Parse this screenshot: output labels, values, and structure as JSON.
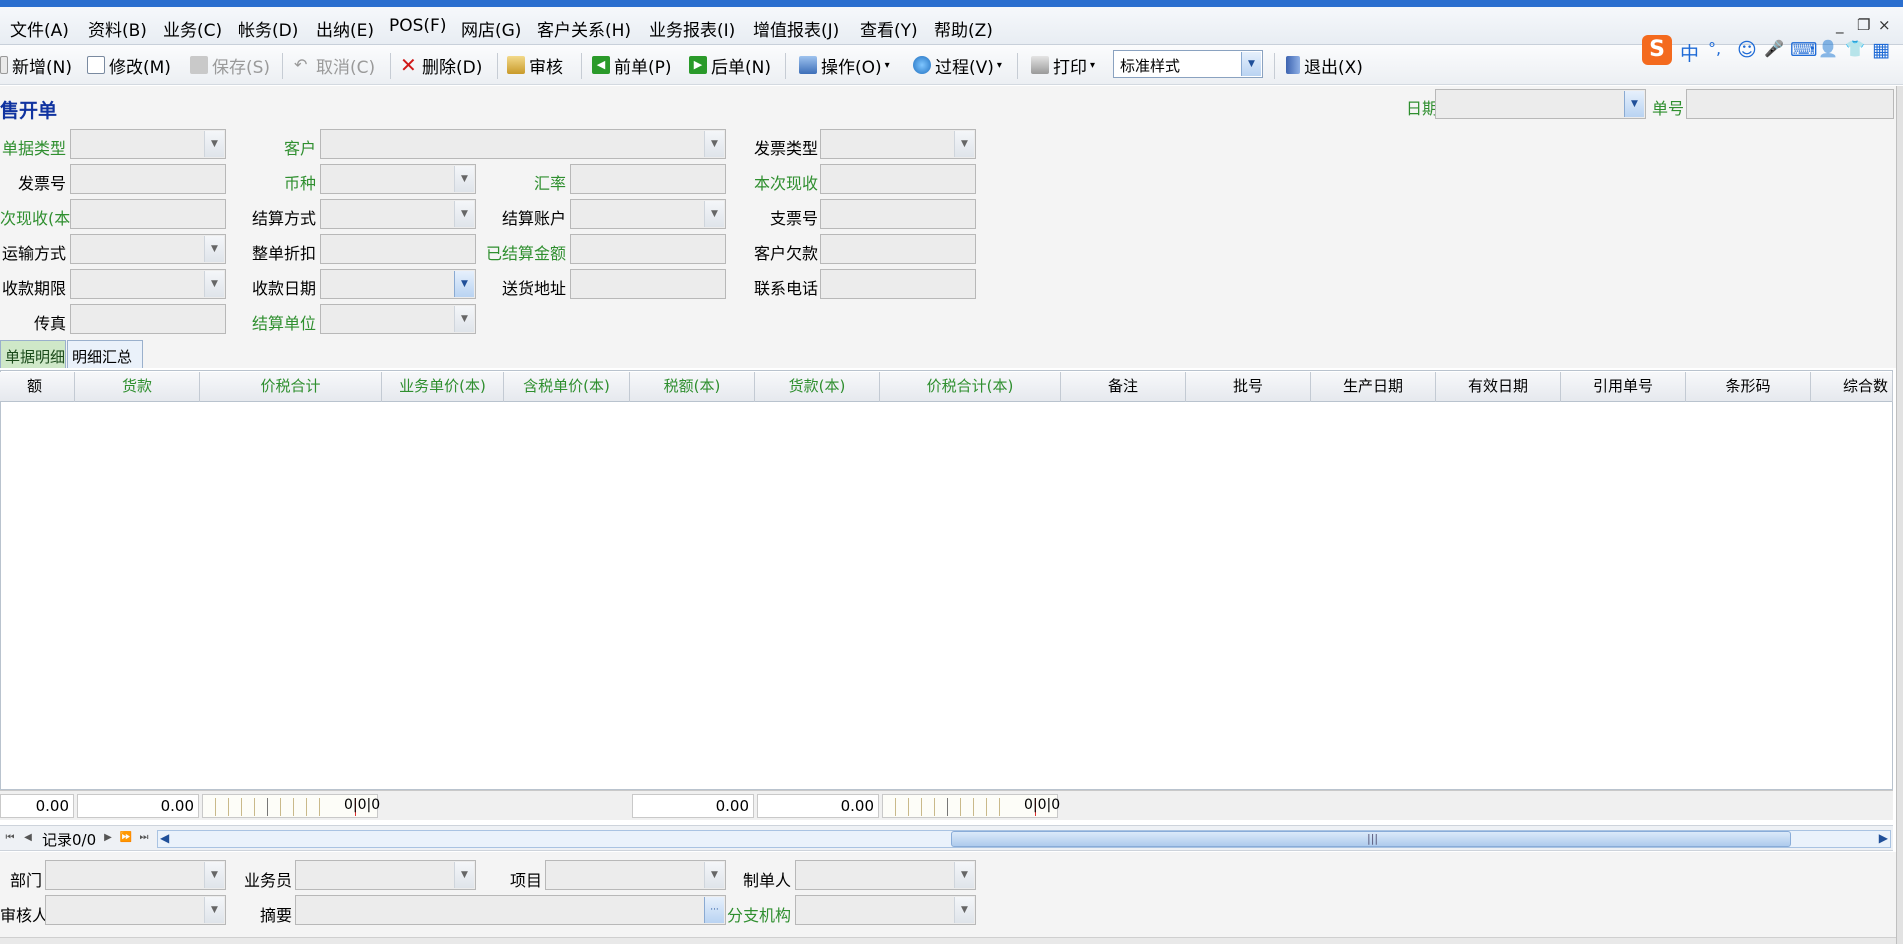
{
  "menu": {
    "items": [
      "文件(A)",
      "资料(B)",
      "业务(C)",
      "帐务(D)",
      "出纳(E)",
      "POS(F)",
      "网店(G)",
      "客户关系(H)",
      "业务报表(I)",
      "增值报表(J)",
      "查看(Y)",
      "帮助(Z)"
    ],
    "win_min": "_",
    "win_restore": "❐",
    "win_close": "×"
  },
  "toolbar": {
    "new": "新增(N)",
    "edit": "修改(M)",
    "save": "保存(S)",
    "cancel": "取消(C)",
    "delete": "删除(D)",
    "audit": "审核",
    "prev": "前单(P)",
    "next": "后单(N)",
    "operate": "操作(O)",
    "process": "过程(V)",
    "print": "打印",
    "style_value": "标准样式",
    "exit": "退出(X)"
  },
  "ime": {
    "logo": "S",
    "lang": "中",
    "punct": "°,",
    "emoji": "☺",
    "mic": "🎤",
    "keyboard": "⌨",
    "user": "👤",
    "shirt": "👕",
    "grid": "▦"
  },
  "form": {
    "title": "售开单",
    "date_label": "日期",
    "no_label": "单号",
    "doc_type": "单据类型",
    "customer": "客户",
    "invoice_type": "发票类型",
    "invoice_no": "发票号",
    "currency": "币种",
    "rate": "汇率",
    "cur_receipt": "本次现收",
    "cur_receipt_base": "次现收(本)",
    "settle_method": "结算方式",
    "settle_account": "结算账户",
    "check_no": "支票号",
    "transport": "运输方式",
    "discount": "整单折扣",
    "settled_amount": "已结算金额",
    "cust_debt": "客户欠款",
    "receipt_term": "收款期限",
    "receipt_date": "收款日期",
    "ship_addr": "送货地址",
    "phone": "联系电话",
    "fax": "传真",
    "settle_unit": "结算单位"
  },
  "tabs": [
    "单据明细",
    "明细汇总"
  ],
  "grid": {
    "columns": [
      "额",
      "货款",
      "价税合计",
      "业务单价(本)",
      "含税单价(本)",
      "税额(本)",
      "货款(本)",
      "价税合计(本)",
      "备注",
      "批号",
      "生产日期",
      "有效日期",
      "引用单号",
      "条形码",
      "综合数"
    ]
  },
  "sums": {
    "s1": "0.00",
    "s2": "0.00",
    "r1": "0|0|0",
    "s3": "0.00",
    "s4": "0.00",
    "r2": "0|0|0"
  },
  "nav": {
    "record": "记录0/0"
  },
  "footer": {
    "dept": "部门",
    "salesman": "业务员",
    "project": "项目",
    "maker": "制单人",
    "auditor": "审核人",
    "summary": "摘要",
    "branch": "分支机构",
    "ellipsis": "···"
  }
}
